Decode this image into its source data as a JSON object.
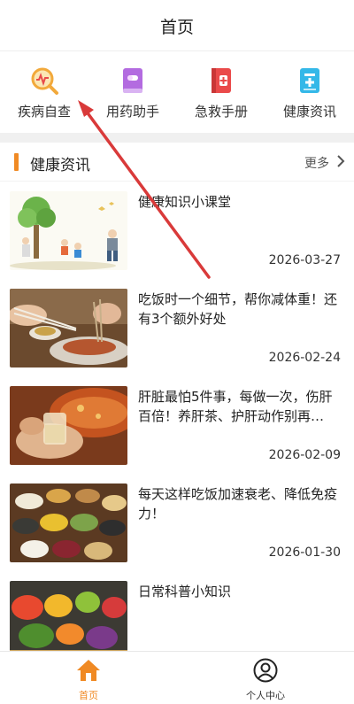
{
  "header": {
    "title": "首页"
  },
  "quick_actions": [
    {
      "label": "疾病自查",
      "icon": "heart-search-icon"
    },
    {
      "label": "用药助手",
      "icon": "medicine-book-icon"
    },
    {
      "label": "急救手册",
      "icon": "first-aid-book-icon"
    },
    {
      "label": "健康资讯",
      "icon": "health-document-icon"
    }
  ],
  "section": {
    "title": "健康资讯",
    "more_label": "更多"
  },
  "news": [
    {
      "title": "健康知识小课堂",
      "date": "2026-03-27",
      "image": "family-exercising-illustration"
    },
    {
      "title": "吃饭时一个细节，帮你减体重！还有3个额外好处",
      "date": "2026-02-24",
      "image": "chopsticks-meal-photo"
    },
    {
      "title": "肝脏最怕5件事，每做一次，伤肝百倍！养肝茶、护肝动作别再…",
      "date": "2026-02-09",
      "image": "liquor-glass-hotpot-photo"
    },
    {
      "title": "每天这样吃饭加速衰老、降低免疫力！",
      "date": "2026-01-30",
      "image": "grains-and-beans-photo"
    },
    {
      "title": "日常科普小知识",
      "date": "",
      "image": "fruits-vegetables-photo"
    }
  ],
  "tabs": [
    {
      "label": "首页",
      "icon": "home-icon",
      "active": true
    },
    {
      "label": "个人中心",
      "icon": "user-profile-icon",
      "active": false
    }
  ],
  "colors": {
    "accent": "#f08a24",
    "annotation_arrow": "#d93a3a"
  }
}
